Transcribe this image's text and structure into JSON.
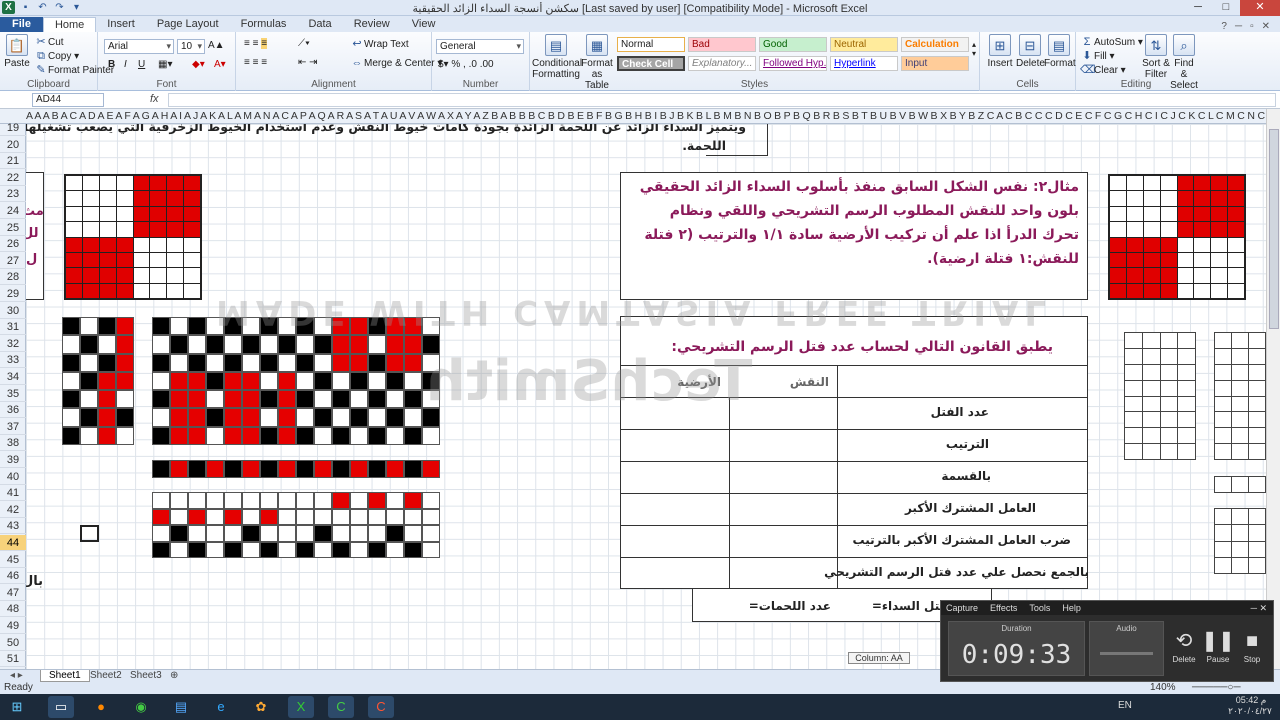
{
  "window": {
    "title": "سكشن أنسجة السداء الزائد الحقيقية [Last saved by user]  [Compatibility Mode] - Microsoft Excel"
  },
  "tabs": [
    "File",
    "Home",
    "Insert",
    "Page Layout",
    "Formulas",
    "Data",
    "Review",
    "View"
  ],
  "ribbon": {
    "clipboard": {
      "label": "Clipboard",
      "paste": "Paste",
      "cut": "Cut",
      "copy": "Copy",
      "format_painter": "Format Painter"
    },
    "font": {
      "label": "Font",
      "name": "Arial",
      "size": "10",
      "bold": "B",
      "italic": "I",
      "underline": "U"
    },
    "alignment": {
      "label": "Alignment",
      "wrap": "Wrap Text",
      "merge": "Merge & Center"
    },
    "number": {
      "label": "Number",
      "format": "General"
    },
    "styles": {
      "label": "Styles",
      "conditional": "Conditional Formatting",
      "format_table": "Format as Table",
      "normal": "Normal",
      "bad": "Bad",
      "good": "Good",
      "neutral": "Neutral",
      "calculation": "Calculation",
      "check_cell": "Check Cell",
      "explanatory": "Explanatory...",
      "followed": "Followed Hyp...",
      "hyperlink": "Hyperlink",
      "input": "Input"
    },
    "cells": {
      "label": "Cells",
      "insert": "Insert",
      "delete": "Delete",
      "format": "Format"
    },
    "editing": {
      "label": "Editing",
      "autosum": "AutoSum",
      "fill": "Fill",
      "clear": "Clear",
      "sort": "Sort & Filter",
      "find": "Find & Select"
    }
  },
  "formula_bar": {
    "name_box": "AD44",
    "fx": "fx",
    "value": ""
  },
  "columns_text": "A A A B A C A D A E A F A G A H  A I  A J A K A L A M A N A C A P A Q A R A S A T A U A V A W A X A Y A Z B A B B B C B D B E B F B G B H  B I  B J B K B L B M B N B O B P B Q B R B S B T B U B V B W B X B Y B Z C A C B C C C D C E C F C G C H  C I  C J C K C L C M C N C C C P C Q",
  "rows": [
    "19",
    "20",
    "21",
    "22",
    "23",
    "24",
    "25",
    "26",
    "27",
    "28",
    "29",
    "30",
    "31",
    "32",
    "33",
    "34",
    "35",
    "36",
    "37",
    "38",
    "39",
    "40",
    "41",
    "42",
    "43",
    "44",
    "45",
    "46",
    "47",
    "48",
    "49",
    "50",
    "51",
    "52"
  ],
  "selected_row": "44",
  "content": {
    "top_text1": "ويتميز السداء الزائد عن اللحمة الزائدة بجودة كامات خيوط النقش وعدم استخدام الخيوط الزخرفية  التي يصعب تشغيلها كسداء",
    "top_text2": "اللحمة.",
    "example_text": "مثال٢:  نفس الشكل السابق منفذ بأسلوب السداء الزائد الحقيقي بلون واحد للنقش المطلوب الرسم التشريحي واللقي ونظام تحرك الدرأ اذا علم أن تركيب الأرضية سادة ١/١ والترتيب (٢ فتلة للنقش:١ فتلة ارضية).",
    "law_title": "يطبق القانون التالي لحساب عدد فتل الرسم التشريحي:",
    "col_pattern": "النقش",
    "col_ground": "الأرضية",
    "row_threads": "عدد الفتل",
    "row_order": "الترتيب",
    "row_division": "بالقسمة",
    "row_gcf": "العامل المشترك الأكبر",
    "row_multiply": "ضرب العامل المشترك الأكبر بالترتيب",
    "row_sum": "بالجمع نحصل علي عدد فتل الرسم التشريحي",
    "warp_count": "عدد فتل السداء=",
    "weft_count": "عدد اللحمات=",
    "left_frag1": "مث",
    "left_frag2": "لل",
    "left_frag3": "ل",
    "left_frag4": "بال",
    "watermark1": "MADE WITH CAMTASIA FREE TRIAL",
    "watermark2": "TechSmith"
  },
  "sheet_tabs": [
    "Sheet1",
    "Sheet2",
    "Sheet3"
  ],
  "status": {
    "text": "Ready",
    "zoom": "140%"
  },
  "column_chip": "Column: AA",
  "recorder": {
    "menu": [
      "Capture",
      "Effects",
      "Tools",
      "Help"
    ],
    "duration_label": "Duration",
    "duration": "0:09:33",
    "audio_label": "Audio",
    "delete": "Delete",
    "pause": "Pause",
    "stop": "Stop"
  },
  "taskbar": {
    "lang": "EN",
    "time": "05:42 م",
    "date": "٢٠٢٠/٠٤/٢٧"
  }
}
